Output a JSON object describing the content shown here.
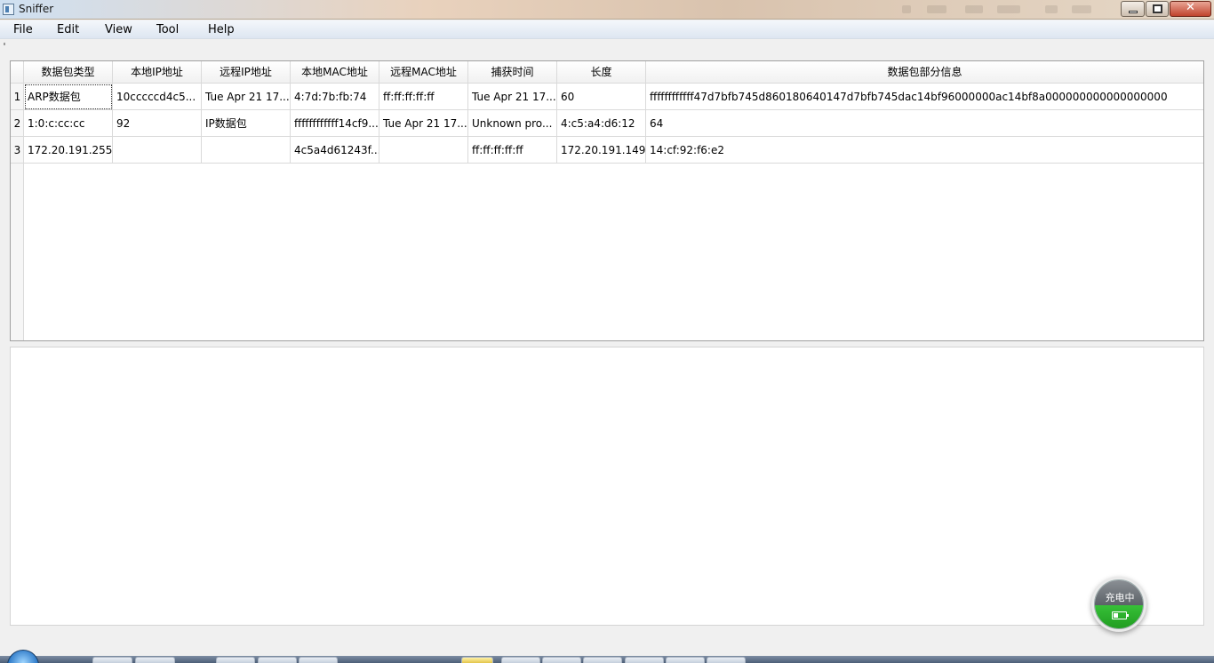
{
  "window": {
    "title": "Sniffer",
    "controls": {
      "minimize": "minimize",
      "maximize": "maximize",
      "close": "✕"
    }
  },
  "menu": [
    "File",
    "Edit",
    "View",
    "Tool",
    "Help"
  ],
  "table": {
    "columns": [
      "数据包类型",
      "本地IP地址",
      "远程IP地址",
      "本地MAC地址",
      "远程MAC地址",
      "捕获时间",
      "长度",
      "数据包部分信息"
    ],
    "rows": [
      {
        "num": "1",
        "cells": [
          "ARP数据包",
          "10cccccd4c5...",
          "Tue Apr 21 17...",
          "4:7d:7b:fb:74",
          "ff:ff:ff:ff:ff",
          "Tue Apr 21 17...",
          "60",
          "ffffffffffff47d7bfb745d860180640147d7bfb745dac14bf96000000ac14bf8a000000000000000000"
        ]
      },
      {
        "num": "2",
        "cells": [
          "1:0:c:cc:cc",
          "92",
          "IP数据包",
          "ffffffffffff14cf9...",
          "Tue Apr 21 17...",
          "Unknown pro...",
          "4:c5:a4:d6:12",
          "64"
        ]
      },
      {
        "num": "3",
        "cells": [
          "172.20.191.255",
          "",
          "",
          "4c5a4d61243f...",
          "",
          "ff:ff:ff:ff:ff",
          "172.20.191.149",
          "14:cf:92:f6:e2"
        ]
      }
    ]
  },
  "charging_badge": {
    "label": "充电中",
    "icon": "battery-icon",
    "color": "#2aaa2b"
  },
  "colors": {
    "titlebar_close": "#c0432c",
    "menubar": "#dde6f1"
  }
}
